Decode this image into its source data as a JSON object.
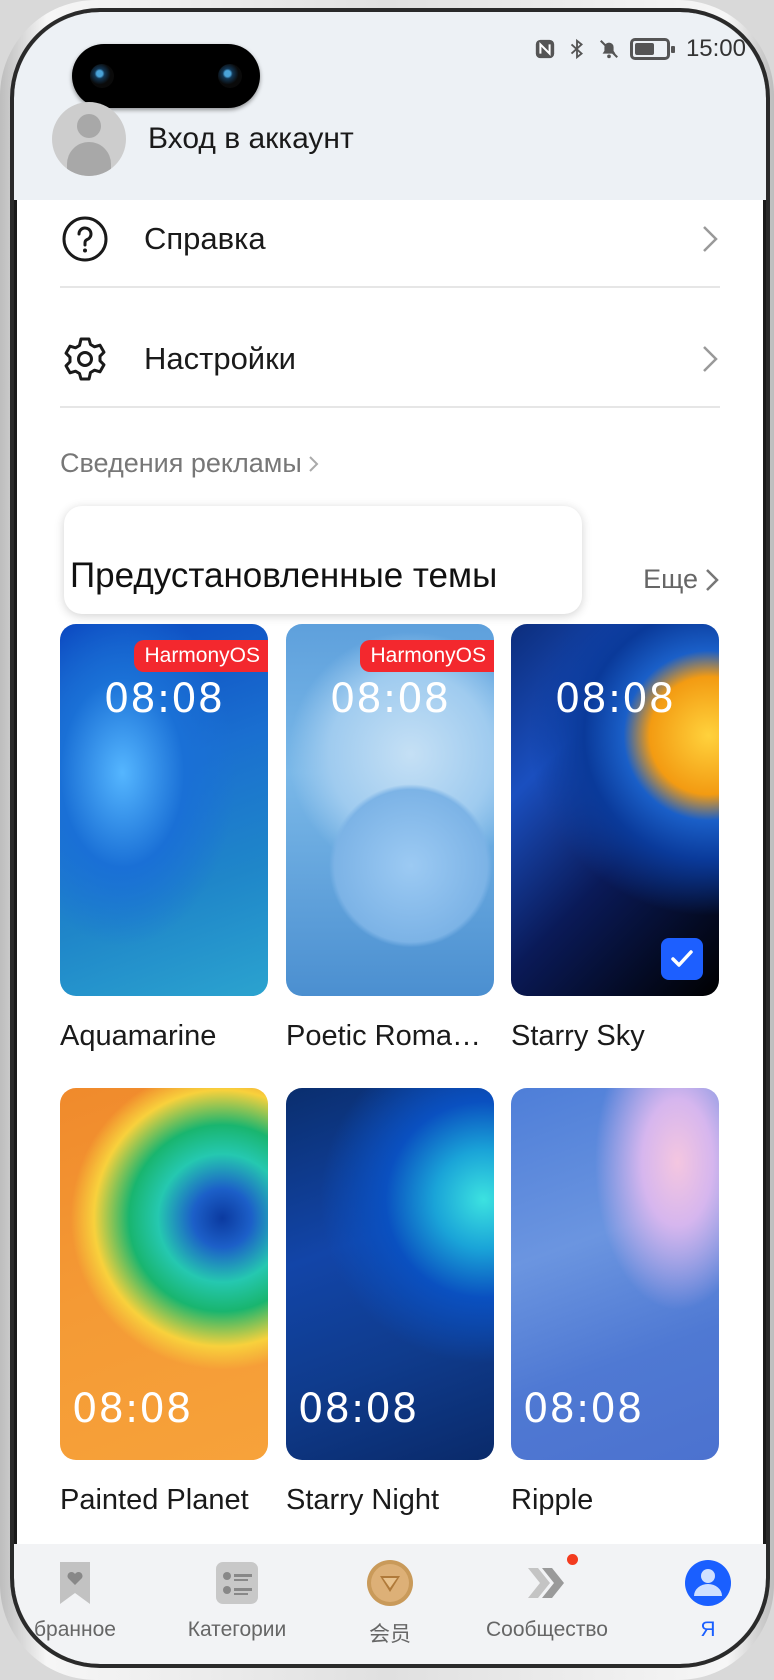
{
  "status_bar": {
    "time": "15:00",
    "icons": [
      "nfc-icon",
      "bluetooth-icon",
      "bell-muted-icon",
      "battery-icon"
    ]
  },
  "account": {
    "label": "Вход в аккаунт"
  },
  "menu": [
    {
      "label": "Справка",
      "icon": "help-icon"
    },
    {
      "label": "Настройки",
      "icon": "gear-icon"
    }
  ],
  "ads_link": "Сведения рекламы",
  "section": {
    "title": "Предустановленные темы",
    "more_label": "Еще"
  },
  "themes": [
    {
      "name": "Aquamarine",
      "clock": "08:08",
      "badge": "HarmonyOS",
      "selected": false
    },
    {
      "name": "Poetic Roma…",
      "clock": "08:08",
      "badge": "HarmonyOS",
      "selected": false
    },
    {
      "name": "Starry Sky",
      "clock": "08:08",
      "badge": null,
      "selected": true
    },
    {
      "name": "Painted Planet",
      "clock": "08:08",
      "badge": null,
      "selected": false
    },
    {
      "name": "Starry Night",
      "clock": "08:08",
      "badge": null,
      "selected": false
    },
    {
      "name": "Ripple",
      "clock": "08:08",
      "badge": null,
      "selected": false
    }
  ],
  "bottom_nav": [
    {
      "label": "бранное",
      "icon": "bookmark-heart-icon",
      "active": false
    },
    {
      "label": "Категории",
      "icon": "list-icon",
      "active": false
    },
    {
      "label": "会员",
      "icon": "vip-coin-icon",
      "active": false
    },
    {
      "label": "Сообщество",
      "icon": "community-chevrons-icon",
      "active": false,
      "notification_dot": true
    },
    {
      "label": "Я",
      "icon": "profile-icon",
      "active": true
    }
  ],
  "colors": {
    "accent": "#1a5fff",
    "badge": "#f3282e",
    "header_bg": "#edf1f5",
    "nav_bg": "#f2f3f5"
  }
}
